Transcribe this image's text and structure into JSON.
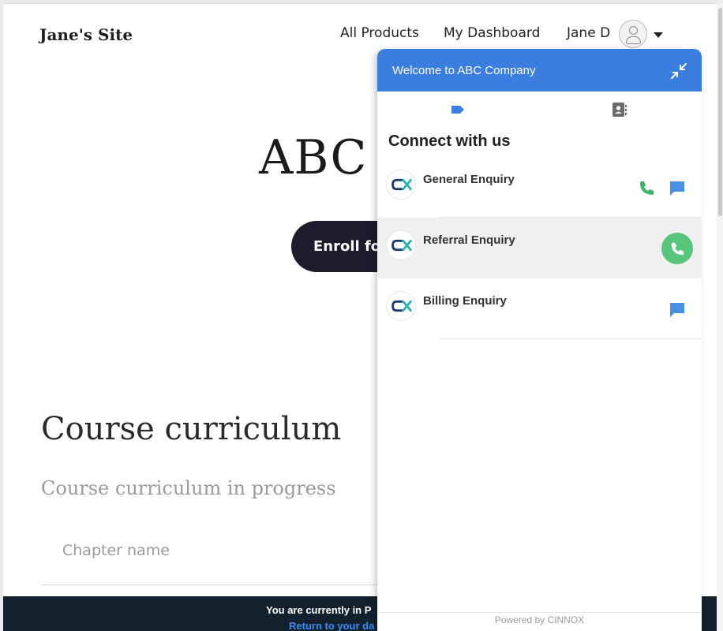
{
  "site": {
    "title": "Jane's Site",
    "nav": {
      "products": "All Products",
      "dashboard": "My Dashboard",
      "user": "Jane D"
    }
  },
  "hero": {
    "title": "ABC",
    "enroll_label": "Enroll for"
  },
  "curriculum": {
    "title": "Course curriculum",
    "subtitle": "Course curriculum in progress",
    "chapter_label": "Chapter name"
  },
  "banner": {
    "text": "You are currently in P",
    "link": "Return to your da"
  },
  "widget": {
    "header_title": "Welcome to ABC Company",
    "connect_title": "Connect with us",
    "tabs": [
      {
        "icon": "tag-icon",
        "active": true
      },
      {
        "icon": "contacts-icon",
        "active": false
      }
    ],
    "enquiries": [
      {
        "label": "General Enquiry",
        "actions": [
          "phone-icon",
          "chat-icon"
        ]
      },
      {
        "label": "Referral Enquiry",
        "actions": [
          "call-button"
        ]
      },
      {
        "label": "Billing Enquiry",
        "actions": [
          "chat-icon"
        ]
      }
    ],
    "powered_by": "Powered by CINNOX",
    "colors": {
      "header": "#3c7de0",
      "call_green": "#57c57a",
      "phone_green": "#3bb36a",
      "chat_blue": "#4a90e2",
      "logo_navy": "#1e3a6e",
      "logo_teal": "#2bb3b1"
    }
  }
}
